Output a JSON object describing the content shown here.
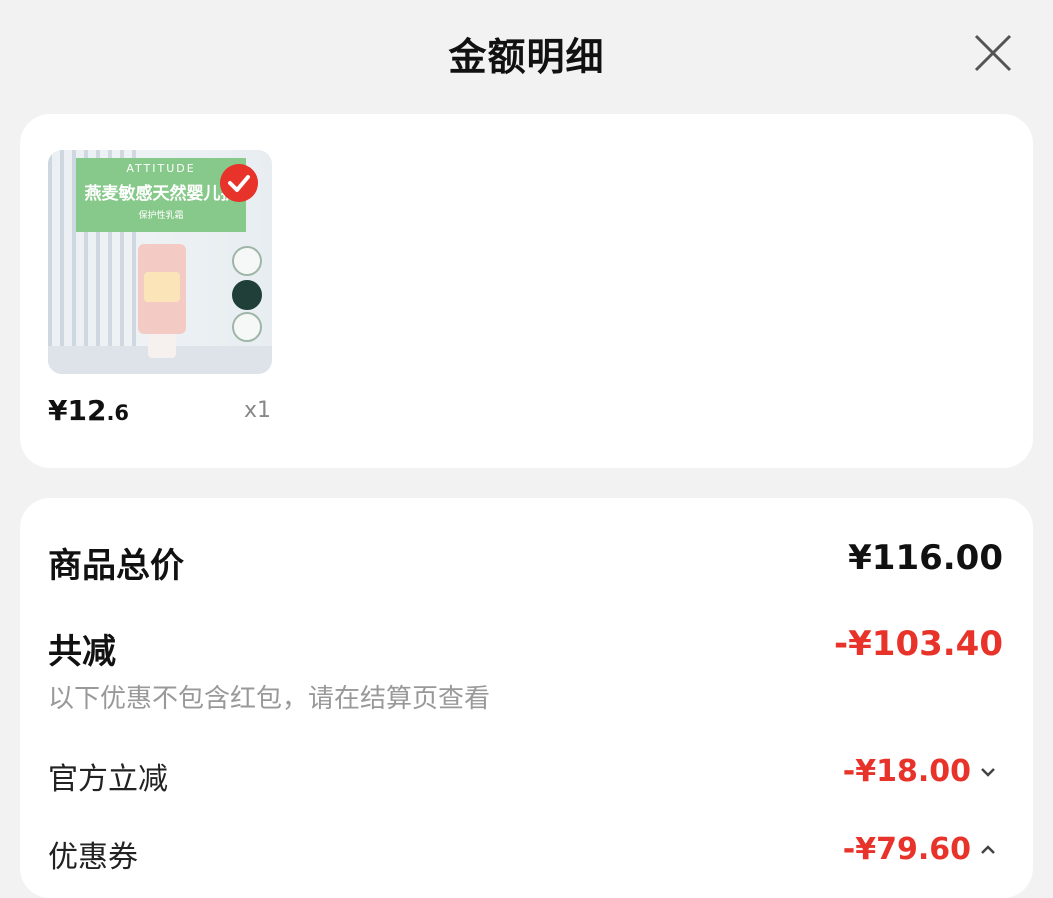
{
  "header": {
    "title": "金额明细",
    "close_icon": "close-icon"
  },
  "product": {
    "image_brand": "ATTITUDE",
    "image_name": "燕麦敏感天然婴儿护",
    "image_sub": "保护性乳霜",
    "price_main": "¥12",
    "price_decimal": ".6",
    "quantity": "x1",
    "selected_icon": "checkmark-icon"
  },
  "summary": {
    "total_label": "商品总价",
    "total_value": "¥116.00",
    "discount_label": "共减",
    "discount_value": "-¥103.40",
    "discount_hint": "以下优惠不包含红包，请在结算页查看",
    "items": [
      {
        "label": "官方立减",
        "value": "-¥18.00",
        "chevron": "chevron-down-icon"
      },
      {
        "label": "优惠券",
        "value": "-¥79.60",
        "chevron": "chevron-up-icon"
      }
    ]
  },
  "colors": {
    "accent_red": "#e8332a",
    "background": "#f2f2f2",
    "card": "#ffffff",
    "image_banner": "#86c98a"
  }
}
